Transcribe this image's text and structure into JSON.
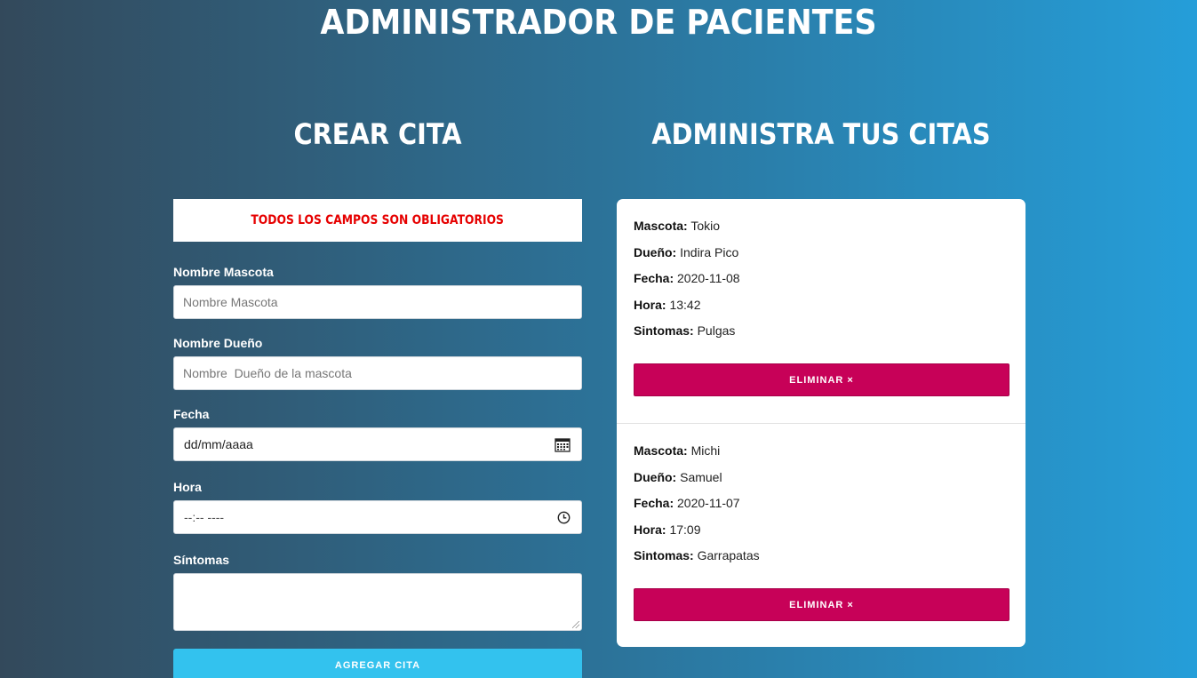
{
  "header": {
    "title": "ADMINISTRADOR DE PACIENTES"
  },
  "form": {
    "title": "CREAR CITA",
    "alert": "TODOS LOS CAMPOS SON OBLIGATORIOS",
    "mascota": {
      "label": "Nombre Mascota",
      "placeholder": "Nombre Mascota",
      "value": ""
    },
    "dueno": {
      "label": "Nombre Dueño",
      "placeholder": "Nombre  Dueño de la mascota",
      "value": ""
    },
    "fecha": {
      "label": "Fecha",
      "placeholder": "dd/mm/aaaa",
      "icon": "calendar-icon"
    },
    "hora": {
      "label": "Hora",
      "placeholder": "--:-- ----",
      "icon": "clock-icon"
    },
    "sintomas": {
      "label": "Síntomas",
      "value": ""
    },
    "submit_label": "AGREGAR CITA"
  },
  "list": {
    "title": "ADMINISTRA TUS CITAS",
    "labels": {
      "mascota": "Mascota:",
      "dueno": "Dueño:",
      "fecha": "Fecha:",
      "hora": "Hora:",
      "sintomas": "Sintomas:"
    },
    "delete_label": "ELIMINAR ×",
    "citas": [
      {
        "mascota": "Tokio",
        "dueno": "Indira Pico",
        "fecha": "2020-11-08",
        "hora": "13:42",
        "sintomas": "Pulgas"
      },
      {
        "mascota": "Michi",
        "dueno": "Samuel",
        "fecha": "2020-11-07",
        "hora": "17:09",
        "sintomas": "Garrapatas"
      }
    ]
  },
  "colors": {
    "gradient_start": "#33495b",
    "gradient_end": "#259ed9",
    "alert_text": "#e60000",
    "add_button": "#33c2ee",
    "delete_button": "#c70158"
  }
}
